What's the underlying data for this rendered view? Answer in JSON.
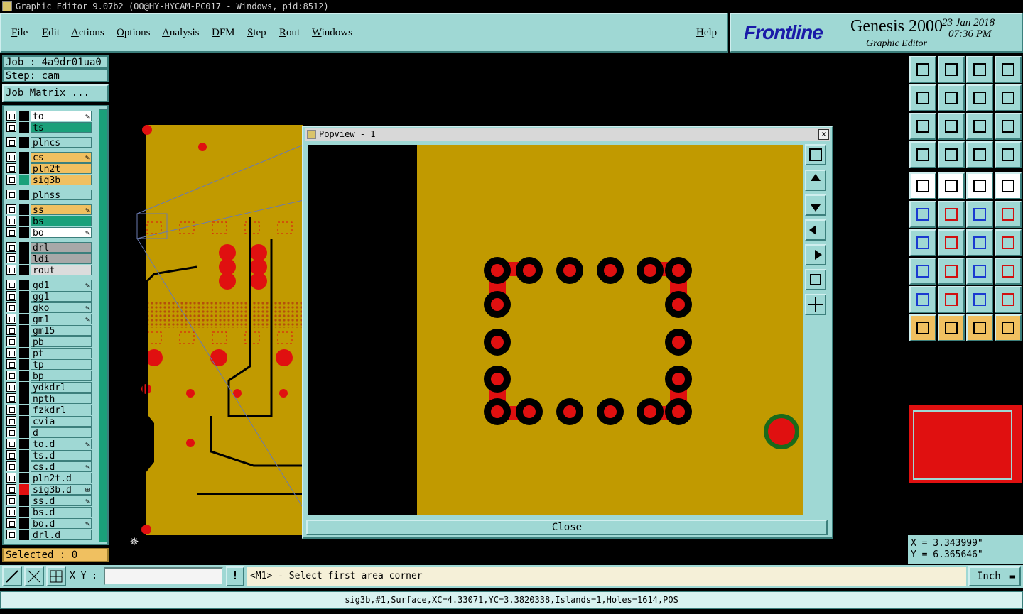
{
  "window": {
    "title": "Graphic Editor 9.07b2 (OO@HY-HYCAM-PC017 - Windows, pid:8512)"
  },
  "menu": {
    "items": [
      {
        "label": "File"
      },
      {
        "label": "Edit"
      },
      {
        "label": "Actions"
      },
      {
        "label": "Options"
      },
      {
        "label": "Analysis"
      },
      {
        "label": "DFM"
      },
      {
        "label": "Step"
      },
      {
        "label": "Rout"
      },
      {
        "label": "Windows"
      }
    ],
    "help": "Help"
  },
  "brand": {
    "logo": "Frontline",
    "product": "Genesis 2000",
    "subtitle": "Graphic Editor",
    "date": "23 Jan 2018",
    "time": "07:36 PM"
  },
  "job": {
    "label": "Job : 4a9dr01ua0",
    "step": "Step: cam",
    "matrix_button": "Job Matrix ..."
  },
  "layers": [
    {
      "name": "to",
      "color": "#ffffff",
      "swatch": "#000000",
      "mark": "pen"
    },
    {
      "name": "ts",
      "color": "#1aa07a",
      "swatch": "#000000",
      "mark": ""
    },
    {
      "name": "plncs",
      "color": "#9fd8d4",
      "swatch": "#000000",
      "mark": ""
    },
    {
      "name": "cs",
      "color": "#f0c060",
      "swatch": "#000000",
      "mark": "pen"
    },
    {
      "name": "pln2t",
      "color": "#f0c060",
      "swatch": "#000000",
      "mark": ""
    },
    {
      "name": "sig3b",
      "color": "#f0c060",
      "swatch": "#1aa07a",
      "mark": ""
    },
    {
      "name": "plnss",
      "color": "#9fd8d4",
      "swatch": "#000000",
      "mark": ""
    },
    {
      "name": "ss",
      "color": "#f0c060",
      "swatch": "#000000",
      "mark": "pen"
    },
    {
      "name": "bs",
      "color": "#1aa07a",
      "swatch": "#000000",
      "mark": ""
    },
    {
      "name": "bo",
      "color": "#ffffff",
      "swatch": "#000000",
      "mark": "pen"
    },
    {
      "name": "drl",
      "color": "#a8a8a8",
      "swatch": "#000000",
      "mark": ""
    },
    {
      "name": "ldi",
      "color": "#a8a8a8",
      "swatch": "#000000",
      "mark": ""
    },
    {
      "name": "rout",
      "color": "#dcdcdc",
      "swatch": "#000000",
      "mark": ""
    },
    {
      "name": "gd1",
      "color": "#9fd8d4",
      "swatch": "#000000",
      "mark": "pen"
    },
    {
      "name": "gg1",
      "color": "#9fd8d4",
      "swatch": "#000000",
      "mark": ""
    },
    {
      "name": "gko",
      "color": "#9fd8d4",
      "swatch": "#000000",
      "mark": "pen"
    },
    {
      "name": "gm1",
      "color": "#9fd8d4",
      "swatch": "#000000",
      "mark": "pen"
    },
    {
      "name": "gm15",
      "color": "#9fd8d4",
      "swatch": "#000000",
      "mark": ""
    },
    {
      "name": "pb",
      "color": "#9fd8d4",
      "swatch": "#000000",
      "mark": ""
    },
    {
      "name": "pt",
      "color": "#9fd8d4",
      "swatch": "#000000",
      "mark": ""
    },
    {
      "name": "tp",
      "color": "#9fd8d4",
      "swatch": "#000000",
      "mark": ""
    },
    {
      "name": "bp",
      "color": "#9fd8d4",
      "swatch": "#000000",
      "mark": ""
    },
    {
      "name": "ydkdrl",
      "color": "#9fd8d4",
      "swatch": "#000000",
      "mark": ""
    },
    {
      "name": "npth",
      "color": "#9fd8d4",
      "swatch": "#000000",
      "mark": ""
    },
    {
      "name": "fzkdrl",
      "color": "#9fd8d4",
      "swatch": "#000000",
      "mark": ""
    },
    {
      "name": "cvia",
      "color": "#9fd8d4",
      "swatch": "#000000",
      "mark": ""
    },
    {
      "name": "d",
      "color": "#9fd8d4",
      "swatch": "#000000",
      "mark": ""
    },
    {
      "name": "to.d",
      "color": "#9fd8d4",
      "swatch": "#000000",
      "mark": "pen"
    },
    {
      "name": "ts.d",
      "color": "#9fd8d4",
      "swatch": "#000000",
      "mark": ""
    },
    {
      "name": "cs.d",
      "color": "#9fd8d4",
      "swatch": "#000000",
      "mark": "pen"
    },
    {
      "name": "pln2t.d",
      "color": "#9fd8d4",
      "swatch": "#000000",
      "mark": ""
    },
    {
      "name": "sig3b.d",
      "color": "#9fd8d4",
      "swatch": "#e01010",
      "mark": "grid"
    },
    {
      "name": "ss.d",
      "color": "#9fd8d4",
      "swatch": "#000000",
      "mark": "pen"
    },
    {
      "name": "bs.d",
      "color": "#9fd8d4",
      "swatch": "#000000",
      "mark": ""
    },
    {
      "name": "bo.d",
      "color": "#9fd8d4",
      "swatch": "#000000",
      "mark": "pen"
    },
    {
      "name": "drl.d",
      "color": "#9fd8d4",
      "swatch": "#000000",
      "mark": ""
    }
  ],
  "selected": "Selected : 0",
  "popview": {
    "title": "Popview - 1",
    "close_label": "Close"
  },
  "coords": {
    "x": "X  =  3.343999\"",
    "y": "Y  =  6.365646\""
  },
  "statusbar": {
    "xy_label": "X Y :",
    "xy_value": "",
    "prompt": "<M1> - Select first area corner",
    "units": "Inch"
  },
  "info_line": "sig3b,#1,Surface,XC=4.33071,YC=3.3820338,Islands=1,Holes=1614,POS"
}
